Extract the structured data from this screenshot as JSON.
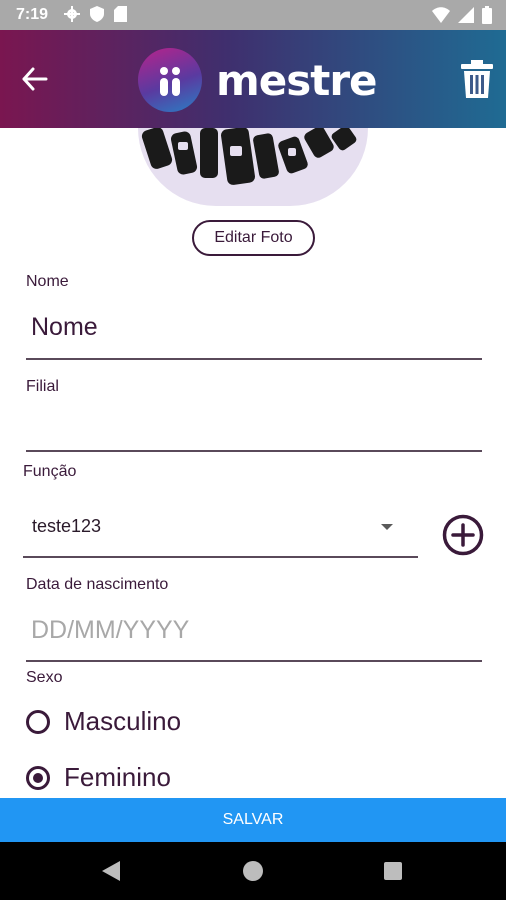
{
  "status_bar": {
    "time": "7:19",
    "left_icons": [
      "gear-icon",
      "shield-icon",
      "sd-card-icon"
    ],
    "right_icons": [
      "wifi-icon",
      "signal-icon",
      "battery-icon"
    ]
  },
  "header": {
    "logo_text": "mestre",
    "back_icon": "arrow-left-icon",
    "delete_icon": "trash-icon",
    "gradient": [
      "#7a1650",
      "#3f2f6e",
      "#1f6b93"
    ]
  },
  "profile": {
    "edit_photo_label": "Editar Foto"
  },
  "form": {
    "nome": {
      "label": "Nome",
      "value": "Nome"
    },
    "filial": {
      "label": "Filial",
      "value": ""
    },
    "funcao": {
      "label": "Função",
      "value": "teste123"
    },
    "nascimento": {
      "label": "Data de nascimento",
      "placeholder": "DD/MM/YYYY"
    },
    "sexo": {
      "label": "Sexo",
      "options": [
        {
          "label": "Masculino",
          "selected": false
        },
        {
          "label": "Feminino",
          "selected": true
        }
      ]
    }
  },
  "actions": {
    "save_label": "SALVAR",
    "save_color": "#2196f3"
  },
  "nav_bar": {
    "icons": [
      "back-triangle-icon",
      "home-circle-icon",
      "recents-square-icon"
    ]
  }
}
